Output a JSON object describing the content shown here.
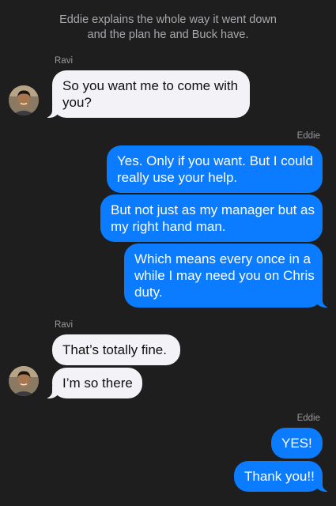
{
  "narration": {
    "line1": "Eddie explains the whole way it went down",
    "line2": "and the plan he and Buck have."
  },
  "messages": [
    {
      "sender": "Ravi",
      "direction": "incoming",
      "bubbles": [
        {
          "lines": [
            "So you want me to come with",
            "you?"
          ]
        }
      ]
    },
    {
      "sender": "Eddie",
      "direction": "outgoing",
      "bubbles": [
        {
          "lines": [
            "Yes. Only if you want. But I could",
            "really use your help."
          ]
        },
        {
          "lines": [
            "But not just as my manager but as",
            "my right hand man."
          ]
        },
        {
          "lines": [
            "Which means every once in a",
            "while I may need you on Chris",
            "duty."
          ]
        }
      ]
    },
    {
      "sender": "Ravi",
      "direction": "incoming",
      "bubbles": [
        {
          "lines": [
            "That’s totally fine."
          ]
        },
        {
          "lines": [
            "I’m so there"
          ]
        }
      ]
    },
    {
      "sender": "Eddie",
      "direction": "outgoing",
      "bubbles": [
        {
          "lines": [
            "YES!"
          ]
        },
        {
          "lines": [
            "Thank you!!"
          ]
        }
      ]
    }
  ],
  "colors": {
    "background": "#1e1e1e",
    "incoming_bubble": "#f2f2f7",
    "outgoing_bubble": "#0b7cff",
    "narration_text": "#a8a8ad",
    "sender_text": "#9a9a9f"
  },
  "avatar": {
    "icon": "person-avatar-icon"
  }
}
